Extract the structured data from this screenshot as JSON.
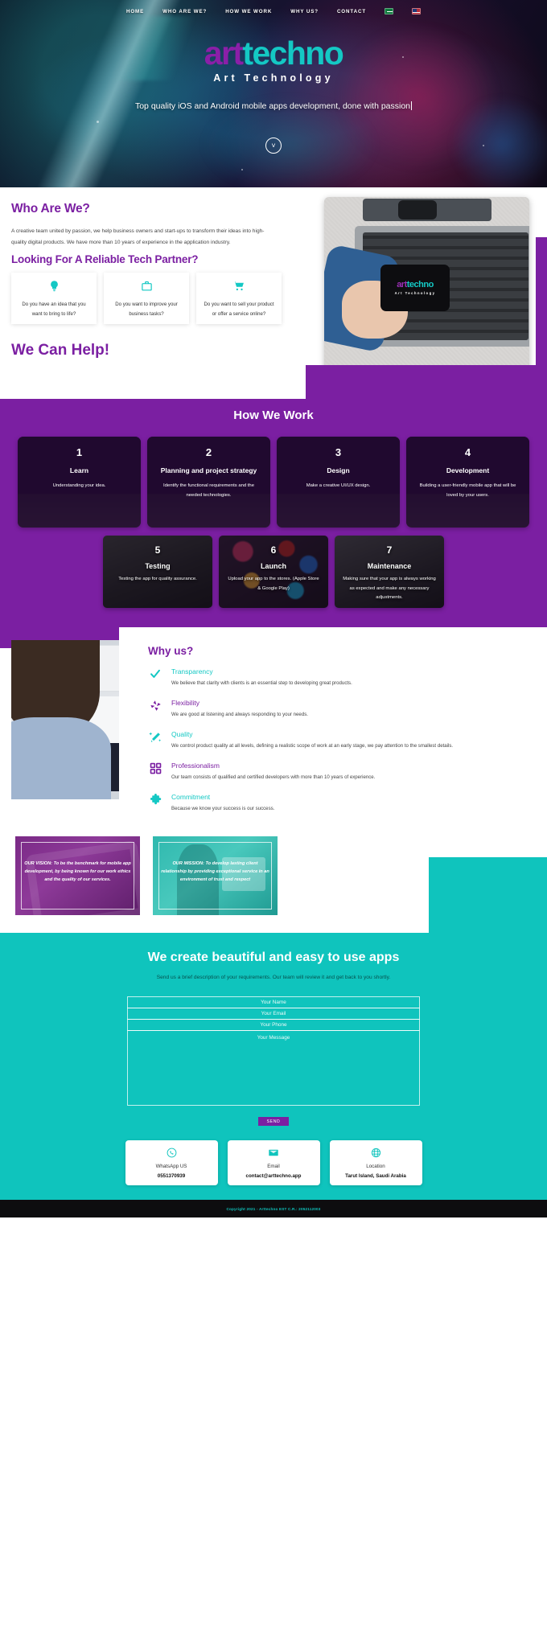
{
  "nav": {
    "items": [
      {
        "label": "HOME"
      },
      {
        "label": "WHO ARE WE?"
      },
      {
        "label": "HOW WE WORK"
      },
      {
        "label": "WHY US?"
      },
      {
        "label": "CONTACT"
      }
    ],
    "flags": [
      {
        "name": "saudi-arabia-flag"
      },
      {
        "name": "united-kingdom-flag"
      }
    ]
  },
  "hero": {
    "logo_part1": "art",
    "logo_part2": "techno",
    "tagline": "Art Technology",
    "subtitle": "Top quality iOS and Android mobile apps development, done with passion",
    "scroll_icon": "chevron-down-icon"
  },
  "who": {
    "heading": "Who Are We?",
    "intro": "A creative team united by passion, we help business owners and start-ups to transform their ideas into high-quality digital products. We have more than 10 years of experience in the application industry.",
    "subheading": "Looking For A Reliable Tech Partner?",
    "cards": [
      {
        "icon": "lightbulb-icon",
        "glyph": "Ὂ1",
        "text": "Do you have an idea that you want to bring to life?"
      },
      {
        "icon": "briefcase-icon",
        "glyph": "ὋC",
        "text": "Do you want to improve your business tasks?"
      },
      {
        "icon": "shopping-cart-icon",
        "glyph": "Ὥ2",
        "text": "Do you want to sell your product or offer a service online?"
      }
    ],
    "cta": "We Can Help!",
    "image_logo_part1": "art",
    "image_logo_part2": "techno",
    "image_logo_tagline": "Art Technology"
  },
  "how_we_work": {
    "heading": "How We Work",
    "steps_row1": [
      {
        "number": "1",
        "title": "Learn",
        "desc": "Understanding your idea."
      },
      {
        "number": "2",
        "title": "Planning and project strategy",
        "desc": "Identify the functional requirements and the needed technologies."
      },
      {
        "number": "3",
        "title": "Design",
        "desc": "Make a creative UI/UX design."
      },
      {
        "number": "4",
        "title": "Development",
        "desc": "Building a user-friendly mobile app that will be loved by your users."
      }
    ],
    "steps_row2": [
      {
        "number": "5",
        "title": "Testing",
        "desc": "Testing the app for quality assurance."
      },
      {
        "number": "6",
        "title": "Launch",
        "desc": "Upload your app to the stores. (Apple Store & Google Play)"
      },
      {
        "number": "7",
        "title": "Maintenance",
        "desc": "Making sure that your app is always working as expected and make any necessary adjustments."
      }
    ]
  },
  "why_us": {
    "heading": "Why us?",
    "items": [
      {
        "icon": "check-icon",
        "title": "Transparency",
        "color": "#14c8c4",
        "desc": "We believe that clarity with clients is an essential step to developing great products."
      },
      {
        "icon": "flexibility-burst-icon",
        "title": "Flexibility",
        "color": "#7b1fa2",
        "desc": "We are good at listening and always responding to your needs."
      },
      {
        "icon": "magic-wand-icon",
        "title": "Quality",
        "color": "#14c8c4",
        "desc": "We control product quality at all levels, defining a realistic scope of work at an early stage, we pay attention to the smallest details."
      },
      {
        "icon": "grid-squares-icon",
        "title": "Professionalism",
        "color": "#7b1fa2",
        "desc": "Our team consists of qualified and certified developers with more than 10 years of experience."
      },
      {
        "icon": "puzzle-piece-icon",
        "title": "Commitment",
        "color": "#14c8c4",
        "desc": "Because we know your success is our success."
      }
    ]
  },
  "vision_mission": {
    "vision": "OUR VISION: To be the benchmark for mobile app development, by being known for our work ethics and the quality of our services.",
    "mission": "OUR MISSION: To develop lasting client relationship by providing exceptional service in an environment of trust and respect"
  },
  "contact": {
    "heading": "We create beautiful and easy to use apps",
    "subtitle": "Send us a brief description of your requirements. Our team will review it and get back to you shortly.",
    "fields": {
      "name_placeholder": "Your Name",
      "email_placeholder": "Your Email",
      "phone_placeholder": "Your Phone",
      "message_placeholder": "Your Message"
    },
    "send_label": "SEND",
    "cards": [
      {
        "icon": "whatsapp-icon",
        "label": "WhatsApp US",
        "value": "0551370939"
      },
      {
        "icon": "envelope-icon",
        "label": "Email",
        "value": "contact@arttechno.app"
      },
      {
        "icon": "globe-icon",
        "label": "Location",
        "value": "Tarut Island, Saudi Arabia"
      }
    ]
  },
  "footer": {
    "copyright": "Copyright 2021 - Arttechno EST C.R.: 2052112003"
  },
  "colors": {
    "purple": "#7b1fa2",
    "teal": "#0fc4bd",
    "dark": "#0d0d0f"
  }
}
